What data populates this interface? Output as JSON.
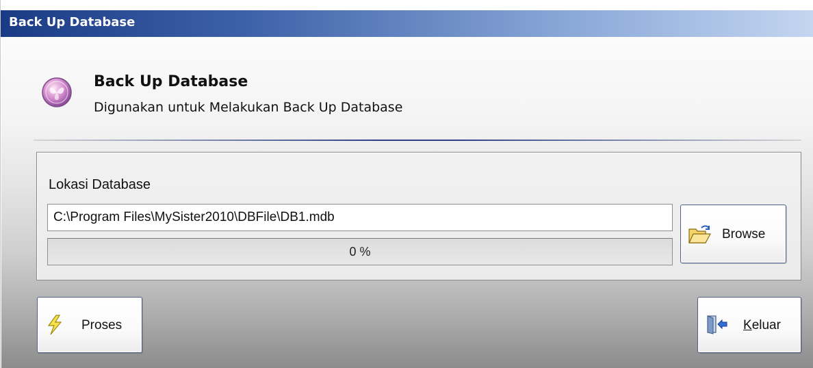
{
  "window": {
    "title": "Back Up Database"
  },
  "header": {
    "icon": "backup-database-icon",
    "title": "Back Up Database",
    "subtitle": "Digunakan untuk Melakukan Back Up Database"
  },
  "location": {
    "label": "Lokasi Database",
    "path_value": "C:\\Program Files\\MySister2010\\DBFile\\DB1.mdb",
    "progress_fraction": 0,
    "progress_text": "0 %",
    "browse_label": "Browse",
    "browse_icon": "folder-open-icon"
  },
  "actions": {
    "proses_label": "Proses",
    "proses_icon": "lightning-icon",
    "keluar_label": "Keluar",
    "keluar_icon": "exit-door-icon"
  },
  "colors": {
    "titlebar_start": "#1a3a85",
    "titlebar_end": "#c4d6f0",
    "divider_accent": "#2c3f86"
  }
}
